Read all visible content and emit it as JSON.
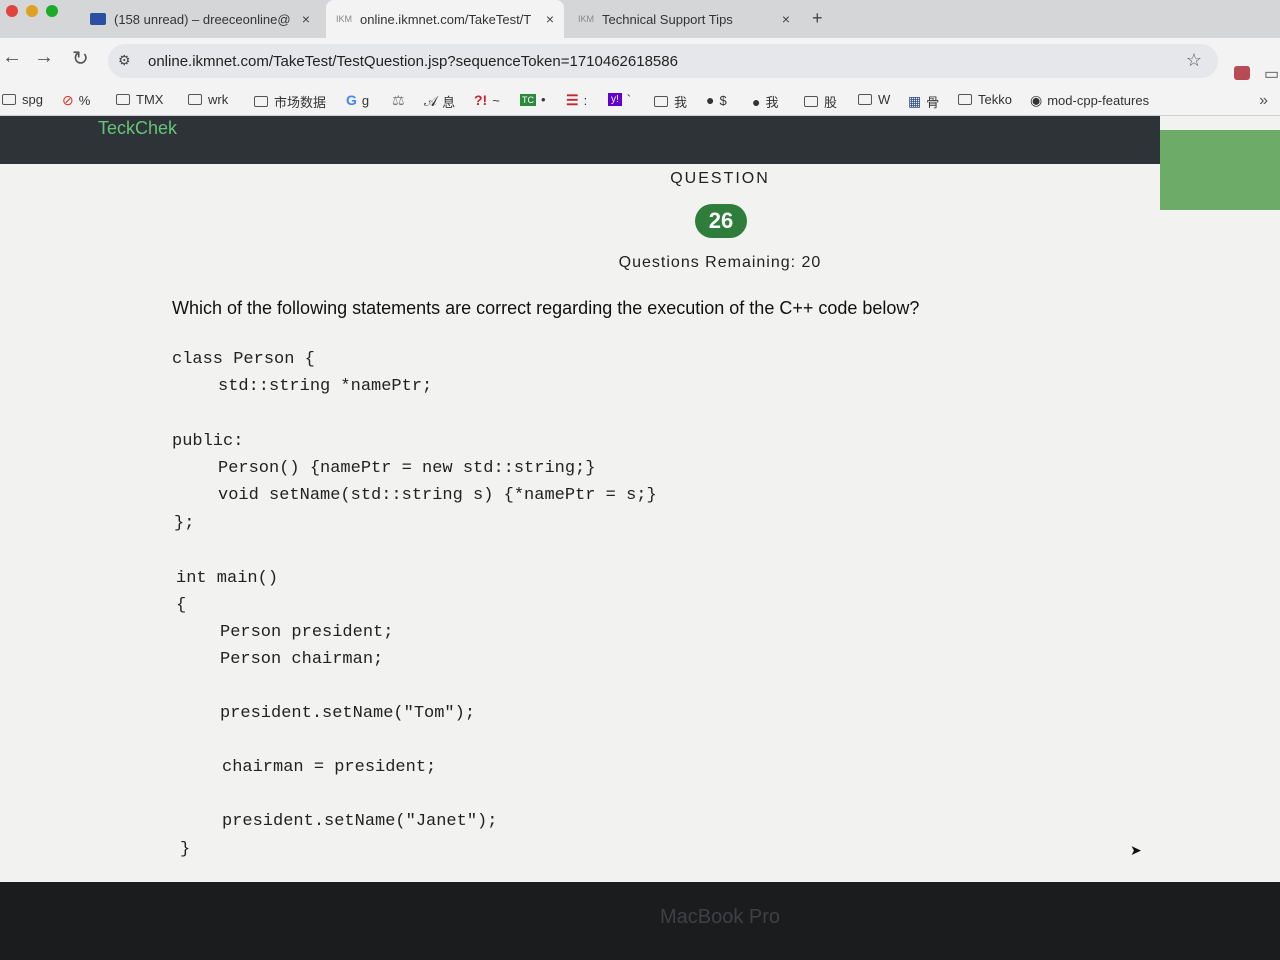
{
  "browser": {
    "tabs": [
      {
        "title": "(158 unread) – dreeceonline@",
        "close": "×"
      },
      {
        "favicon": "IKM",
        "title": "online.ikmnet.com/TakeTest/T",
        "close": "×"
      },
      {
        "favicon": "IKM",
        "title": "Technical Support Tips",
        "close": "×"
      }
    ],
    "new_tab": "+",
    "url": "online.ikmnet.com/TakeTest/TestQuestion.jsp?sequenceToken=1710462618586",
    "bookmarks": [
      {
        "icon": "folder-icon",
        "label": "spg"
      },
      {
        "icon": "blocked-icon",
        "label": "%"
      },
      {
        "icon": "folder-icon",
        "label": "TMX"
      },
      {
        "icon": "folder-icon",
        "label": "wrk"
      },
      {
        "icon": "folder-icon",
        "label": "市场数据"
      },
      {
        "icon": "google-icon",
        "label": "g"
      },
      {
        "icon": "chart-icon",
        "label": ""
      },
      {
        "icon": "script-icon",
        "label": "息"
      },
      {
        "icon": "alert-icon",
        "label": "~"
      },
      {
        "icon": "tc-icon",
        "label": "•"
      },
      {
        "icon": "menu-icon",
        "label": ":"
      },
      {
        "icon": "yahoo-icon",
        "label": "`"
      },
      {
        "icon": "folder-icon",
        "label": "我"
      },
      {
        "icon": "globe-icon",
        "label": "$"
      },
      {
        "icon": "globe-icon",
        "label": "我"
      },
      {
        "icon": "folder-icon",
        "label": "股"
      },
      {
        "icon": "folder-icon",
        "label": "W"
      },
      {
        "icon": "grid-icon",
        "label": "骨"
      },
      {
        "icon": "folder-icon",
        "label": "Tekko"
      },
      {
        "icon": "github-icon",
        "label": "mod-cpp-features"
      }
    ]
  },
  "page": {
    "brand": "TeckChek",
    "question_label": "QUESTION",
    "question_number": "26",
    "remaining": "Questions Remaining: 20",
    "prompt": "Which of the following statements are correct regarding the execution of the C++ code below?",
    "code_lines": [
      "class Person {",
      "std::string *namePtr;",
      "",
      "public:",
      "Person() {namePtr = new std::string;}",
      "void setName(std::string s) {*namePtr = s;}",
      "};",
      "",
      "int main()",
      "{",
      "Person president;",
      "Person chairman;",
      "",
      "president.setName(\"Tom\");",
      "",
      "chairman = president;",
      "",
      "president.setName(\"Janet\");",
      "}"
    ]
  },
  "device": {
    "label": "MacBook Pro"
  },
  "colors": {
    "brand": "#66c47a",
    "badge": "#2f7d3b",
    "header": "#2d3337"
  }
}
